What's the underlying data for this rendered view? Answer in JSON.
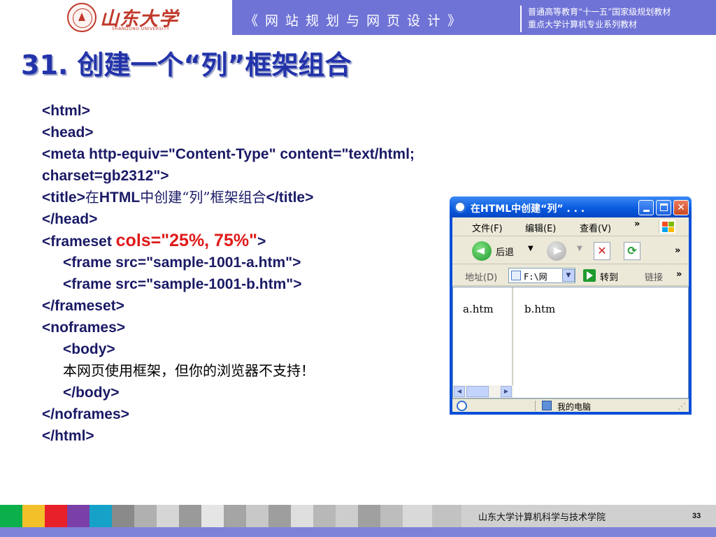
{
  "header": {
    "university_name_cn": "山东大学",
    "university_name_en": "SHANDONG UNIVERSITY",
    "course_title": "《网站规划与网页设计》",
    "series_line_1": "普通高等教育“十一五”国家级规划教材",
    "series_line_2": "重点大学计算机专业系列教材"
  },
  "slide": {
    "title": "31. 创建一个“列”框架组合"
  },
  "code": {
    "l1": "<html>",
    "l2": "<head>",
    "l3": "<meta http-equiv=\"Content-Type\" content=\"text/html;",
    "l4": "charset=gb2312\">",
    "l5_a": "<title>",
    "l5_b": "在",
    "l5_c": "HTML",
    "l5_d": "中创建“列”框架组合",
    "l5_e": "</title>",
    "l6": "</head>",
    "l7_a": "<frameset ",
    "l7_b": "cols=\"25%, 75%\"",
    "l7_c": ">",
    "l8": "<frame src=\"sample-1001-a.htm\">",
    "l9": "<frame src=\"sample-1001-b.htm\">",
    "l10": "</frameset>",
    "l11": "<noframes>",
    "l12": "<body>",
    "l13": "本网页使用框架，但你的浏览器不支持！",
    "l14": "</body>",
    "l15": "</noframes>",
    "l16": "</html>"
  },
  "browser": {
    "title": "在HTML中创建“列” . . .",
    "menu": [
      "文件(F)",
      "编辑(E)",
      "查看(V)"
    ],
    "menu_more": "»",
    "toolbar": {
      "back_label": "后退",
      "more": "»"
    },
    "address": {
      "label": "地址(D)",
      "value": "F:\\网",
      "go_label": "转到",
      "links_label": "链接",
      "links_more": "»"
    },
    "frame_a_text": "a.htm",
    "frame_b_text": "b.htm",
    "status_text": "我的电脑"
  },
  "footer": {
    "school": "山东大学计算机科学与技术学院",
    "page_number": "33"
  },
  "colors": {
    "header_bg": "#6f73d6",
    "title_color": "#2233aa",
    "code_color": "#1a1a66",
    "highlight_red": "#e01a1a"
  }
}
